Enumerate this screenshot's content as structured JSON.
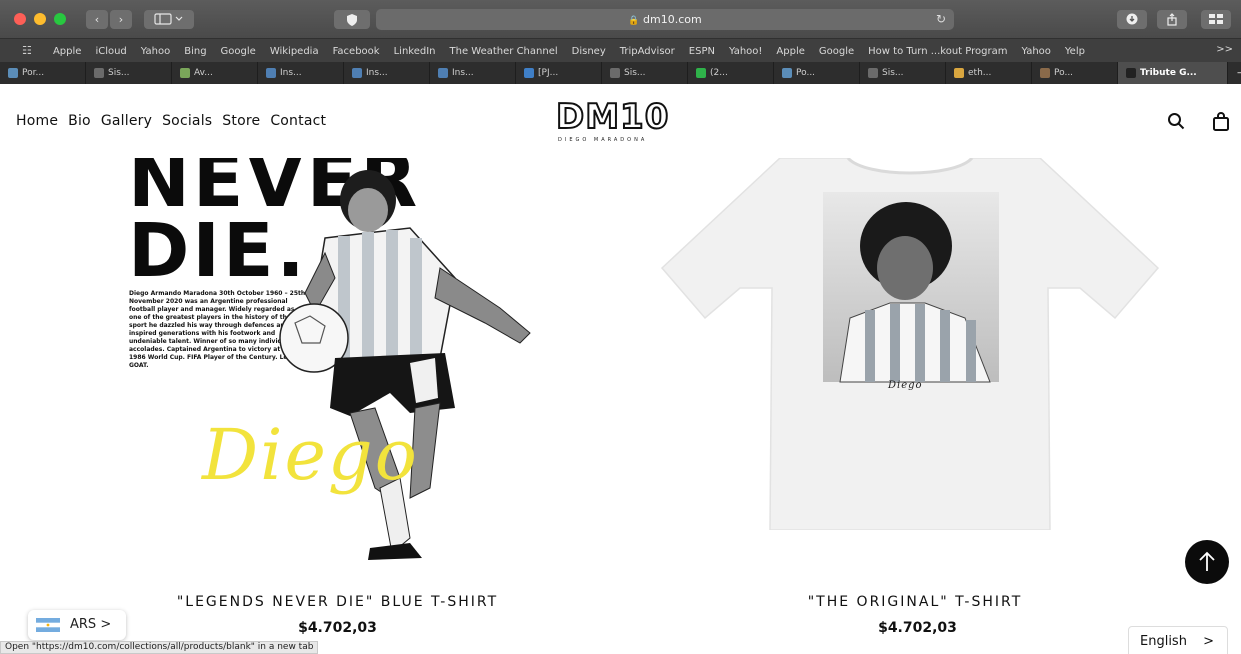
{
  "browser": {
    "url": "dm10.com",
    "favorites": [
      "Apple",
      "iCloud",
      "Yahoo",
      "Bing",
      "Google",
      "Wikipedia",
      "Facebook",
      "LinkedIn",
      "The Weather Channel",
      "Disney",
      "TripAdvisor",
      "ESPN",
      "Yahoo!",
      "Apple",
      "Google",
      "How to Turn ...kout Program",
      "Yahoo",
      "Yelp"
    ],
    "favorites_more": ">>",
    "tabs": [
      "Por...",
      "Sis...",
      "Av...",
      "Ins...",
      "Ins...",
      "Ins...",
      "[PJ...",
      "Sis...",
      "(2...",
      "Po...",
      "Sis...",
      "eth...",
      "Po...",
      "Tribute G..."
    ],
    "tab_plus": "+"
  },
  "header": {
    "nav": [
      "Home",
      "Bio",
      "Gallery",
      "Socials",
      "Store",
      "Contact"
    ],
    "logo_text": "DM10",
    "logo_sub": "DIEGO MARADONA"
  },
  "products": [
    {
      "poster_title_1": "NEVER",
      "poster_title_2": "DIE.",
      "poster_bio": "Diego Armando Maradona 30th October 1960 – 25th November 2020 was an Argentine professional football player and manager. Widely regarded as one of the greatest players in the history of the sport he dazzled his way through defences and inspired generations with his footwork and undeniable talent. Winner of so many individual accolades. Captained Argentina to victory at the 1986 World Cup. FIFA Player of the Century. Legend. GOAT.",
      "poster_script": "Diego",
      "title": "\"LEGENDS NEVER DIE\" BLUE T-SHIRT",
      "price": "$4.702,03"
    },
    {
      "shirt_signature": "Diego",
      "title": "\"THE ORIGINAL\" T-SHIRT",
      "price": "$4.702,03"
    }
  ],
  "currency": {
    "label": "ARS",
    "chevron": ">"
  },
  "language": {
    "label": "English",
    "chevron": ">"
  },
  "status_tip": "Open \"https://dm10.com/collections/all/products/blank\" in a new tab",
  "colors": {
    "accent_yellow": "#f2e33c",
    "text_dark": "#111111"
  }
}
